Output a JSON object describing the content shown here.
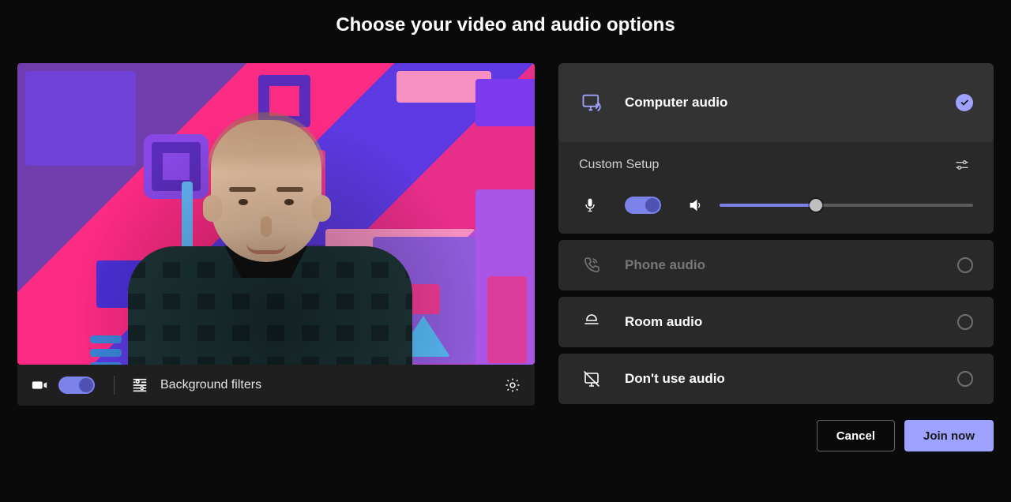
{
  "title": "Choose your video and audio options",
  "video": {
    "camera_on": true,
    "bg_filters_label": "Background filters"
  },
  "audio": {
    "setup_label": "Custom Setup",
    "mic_on": true,
    "volume_percent": 38,
    "options": [
      {
        "id": "computer",
        "label": "Computer audio",
        "selected": true,
        "disabled": false
      },
      {
        "id": "phone",
        "label": "Phone audio",
        "selected": false,
        "disabled": true
      },
      {
        "id": "room",
        "label": "Room audio",
        "selected": false,
        "disabled": false
      },
      {
        "id": "none",
        "label": "Don't use audio",
        "selected": false,
        "disabled": false
      }
    ]
  },
  "footer": {
    "cancel_label": "Cancel",
    "join_label": "Join now"
  },
  "colors": {
    "accent": "#9ea2ff",
    "toggle": "#7b83eb"
  }
}
